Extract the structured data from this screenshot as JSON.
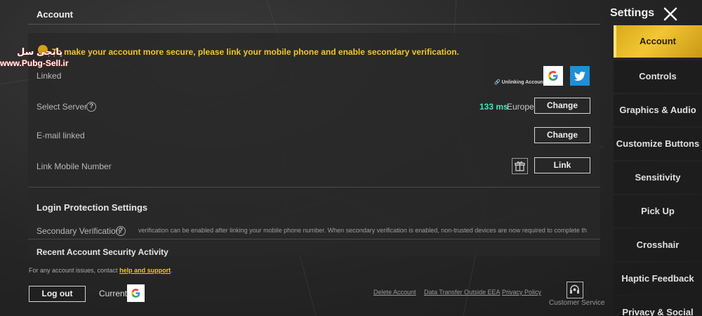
{
  "header": {
    "account_title": "Account",
    "settings_title": "Settings"
  },
  "watermark": {
    "persian": "پابجی سل",
    "site": "www.Pubg-Sell.ir"
  },
  "notice": "To make your account more secure, please link your mobile phone and enable secondary verification.",
  "rows": {
    "linked": "Linked",
    "unlinking": "Unlinking Accounts",
    "select_server": "Select Server",
    "ping": "133 ms",
    "region": "Europe",
    "change_label": "Change",
    "email_linked": "E-mail linked",
    "change_email_label": "Change",
    "link_mobile": "Link Mobile Number",
    "link_label": "Link"
  },
  "login_protection": {
    "title": "Login Protection Settings",
    "secondary_label": "Secondary Verification",
    "secondary_desc": "verification can be enabled after linking your mobile phone number. When secondary verification is enabled, non-trusted devices are now required to complete th",
    "recent_activity": "Recent Account Security Activity"
  },
  "footer": {
    "issue_text": "For any account issues, contact ",
    "issue_link": "help and support",
    "issue_end": ".",
    "logout": "Log out",
    "current": "Current",
    "delete_account": "Delete Account",
    "data_transfer": "Data Transfer Outside EEA",
    "privacy_policy": "Privacy Policy",
    "customer_service": "Customer Service"
  },
  "nav": {
    "items": [
      {
        "label": "Account",
        "active": true
      },
      {
        "label": "Controls"
      },
      {
        "label": "Graphics & Audio"
      },
      {
        "label": "Customize Buttons"
      },
      {
        "label": "Sensitivity"
      },
      {
        "label": "Pick Up"
      },
      {
        "label": "Crosshair"
      },
      {
        "label": "Haptic Feedback"
      },
      {
        "label": "Privacy & Social"
      }
    ]
  },
  "icons": {
    "close": "close-icon",
    "help": "help-icon",
    "google": "google-icon",
    "twitter": "twitter-icon",
    "gift": "gift-icon",
    "link": "link-icon",
    "customer_service": "headset-icon"
  },
  "colors": {
    "accent": "#f3c623",
    "ping": "#3fe6b8",
    "twitter": "#1f8fd8"
  }
}
